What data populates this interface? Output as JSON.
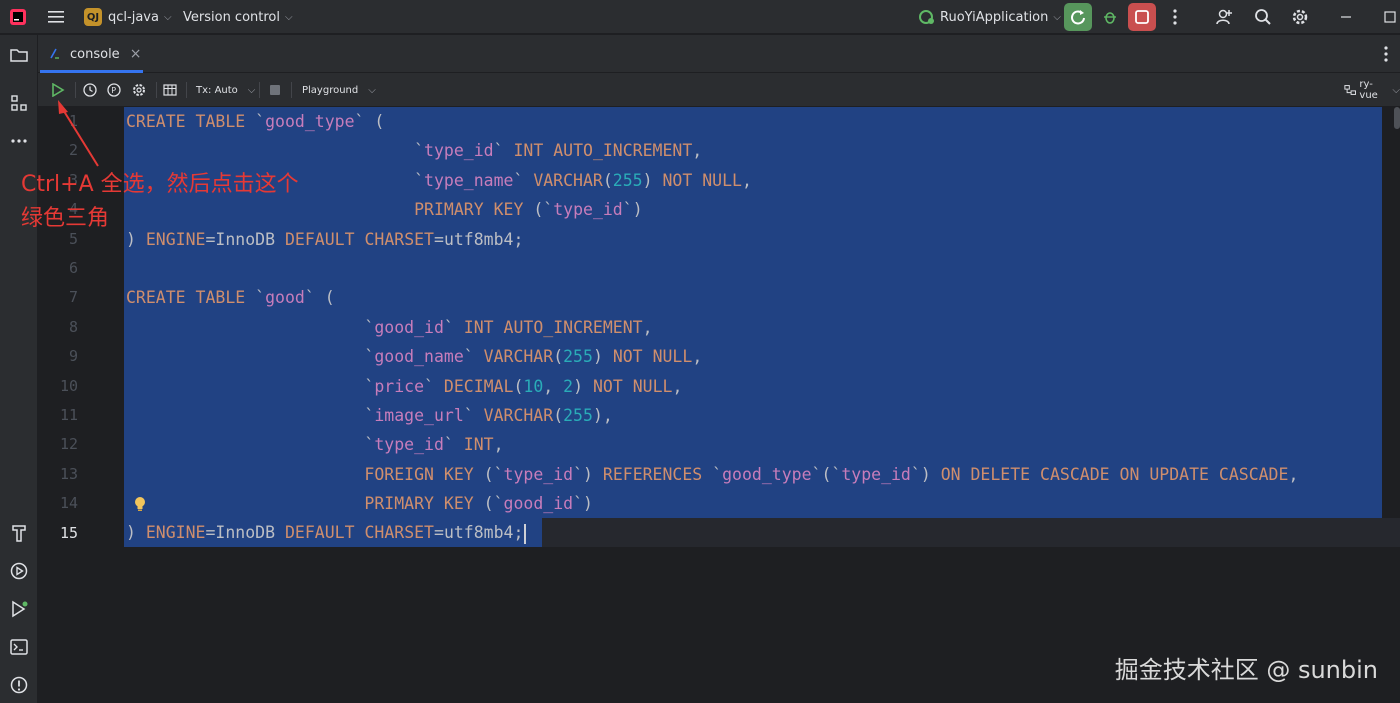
{
  "titlebar": {
    "project_badge": "QJ",
    "project_name": "qcl-java",
    "version_control": "Version control",
    "run_config": "RuoYiApplication"
  },
  "tab": {
    "label": "console",
    "close": "×"
  },
  "toolbar": {
    "tx_mode": "Tx: Auto",
    "playground": "Playground",
    "datasource": "ry-vue"
  },
  "editor": {
    "line_numbers": [
      "1",
      "2",
      "3",
      "4",
      "5",
      "6",
      "7",
      "8",
      "9",
      "10",
      "11",
      "12",
      "13",
      "14",
      "15"
    ],
    "current_line": "15"
  },
  "annotation": {
    "line1": "Ctrl+A 全选，然后点击这个",
    "line2": "绿色三角"
  },
  "watermark": "掘金技术社区 @ sunbin",
  "colors": {
    "background": "#1e1f22",
    "panel": "#2b2d30",
    "selection": "#214283",
    "keyword": "#cf8e6d",
    "number": "#2aacb8",
    "identifier": "#c77dbb",
    "annotation": "#e53935",
    "accent": "#3574f0"
  }
}
